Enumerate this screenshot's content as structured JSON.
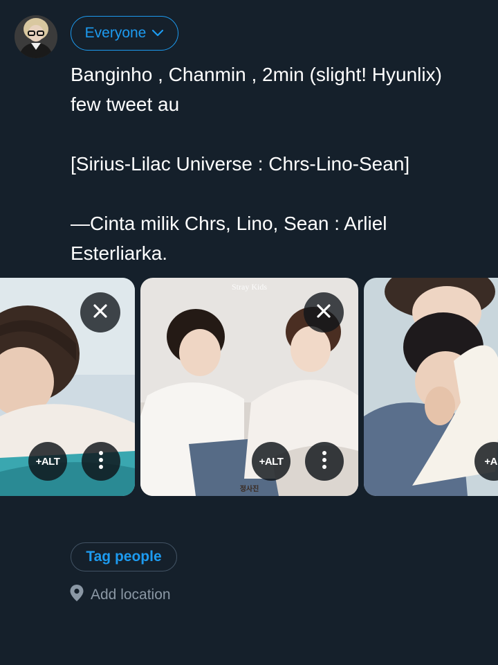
{
  "composer": {
    "audience_label": "Everyone",
    "tweet_text": "Banginho , Chanmin , 2min (slight! Hyunlix)\nfew tweet au\n\n[Sirius-Lilac Universe : Chrs-Lino-Sean]\n\n—Cinta milik Chrs, Lino, Sean : Arliel\nEsterliarka."
  },
  "media": [
    {
      "alt_label": "+ALT",
      "remove_icon": "close-icon",
      "menu_icon": "more-vertical-icon"
    },
    {
      "alt_label": "+ALT",
      "remove_icon": "close-icon",
      "menu_icon": "more-vertical-icon",
      "watermark_top": "Stray Kids",
      "watermark_bottom": "정사진"
    },
    {
      "alt_label": "+AL",
      "remove_icon": "close-icon"
    }
  ],
  "actions": {
    "tag_people_label": "Tag people",
    "add_location_label": "Add location",
    "location_icon": "location-pin-icon"
  },
  "colors": {
    "background": "#15202b",
    "accent": "#1d9bf0",
    "muted": "#8b98a5"
  }
}
